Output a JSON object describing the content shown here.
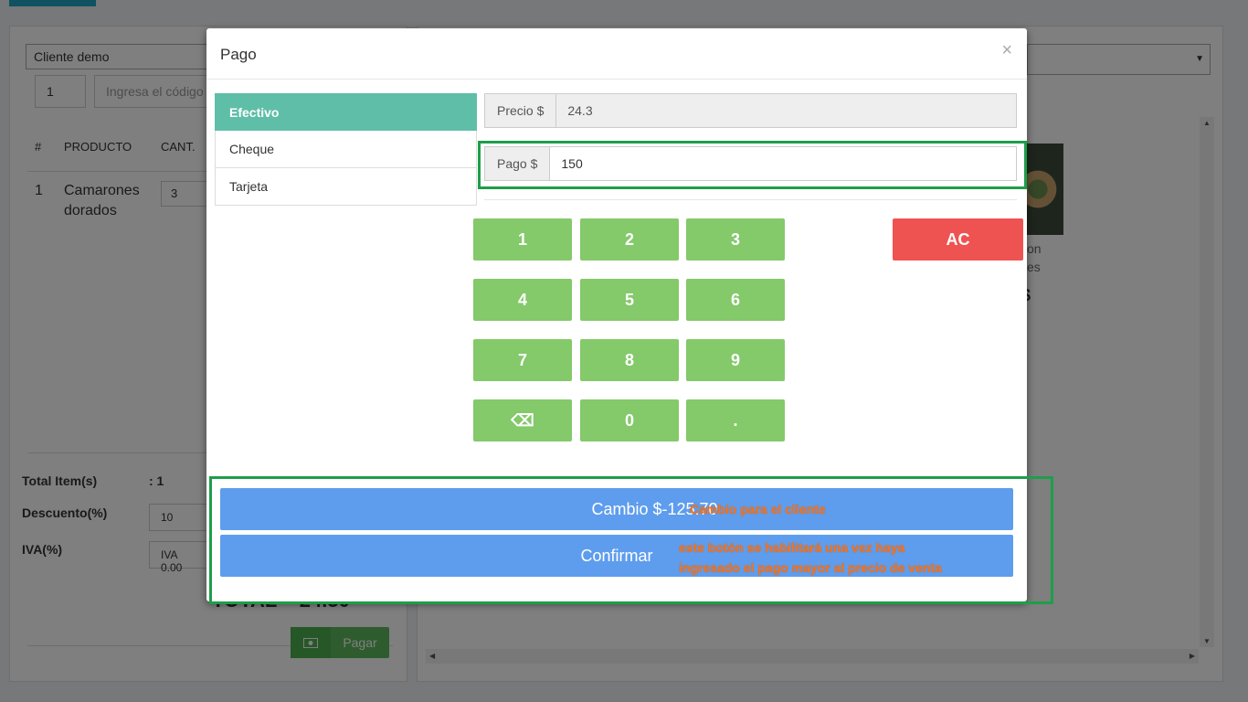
{
  "background": {
    "client": "Cliente demo",
    "qty": "1",
    "code_placeholder": "Ingresa el código",
    "table_headers": [
      "#",
      "PRODUCTO",
      "CANT."
    ],
    "row": {
      "num": "1",
      "product_line1": "Camarones",
      "product_line2": "dorados",
      "qty": "3"
    },
    "total_items_label": "Total Item(s)",
    "total_items_value": ": 1",
    "discount_label": "Descuento(%)",
    "discount_value": "10",
    "iva_label": "IVA(%)",
    "iva_value": "IVA 0.00",
    "total_label": "TOTAL",
    "total_value": "24.30",
    "pay_label": "Pagar",
    "food_line1": "on",
    "food_line2": "es",
    "food_price": "$"
  },
  "modal": {
    "title": "Pago",
    "close": "×",
    "tabs": [
      {
        "label": "Efectivo",
        "active": true
      },
      {
        "label": "Cheque",
        "active": false
      },
      {
        "label": "Tarjeta",
        "active": false
      }
    ],
    "price_label": "Precio $",
    "price_value": "24.3",
    "pay_label": "Pago $",
    "pay_value": "150",
    "keypad": [
      "1",
      "2",
      "3",
      "4",
      "5",
      "6",
      "7",
      "8",
      "9",
      "⌫",
      "0",
      "."
    ],
    "clear_label": "AC",
    "change_label": "Cambio $-125.70",
    "confirm_label": "Confirmar",
    "annotation_change": "Cambio para el cliente",
    "annotation_confirm_1": "este botón se habilitará una vez haya",
    "annotation_confirm_2": "ingresado el pago mayor al precio de venta"
  },
  "colors": {
    "active_tab": "#5fbea8",
    "keypad": "#84c96a",
    "clear": "#ef5351",
    "action": "#5e9ded",
    "highlight": "#1e9e4a",
    "annotation": "#f27521"
  }
}
